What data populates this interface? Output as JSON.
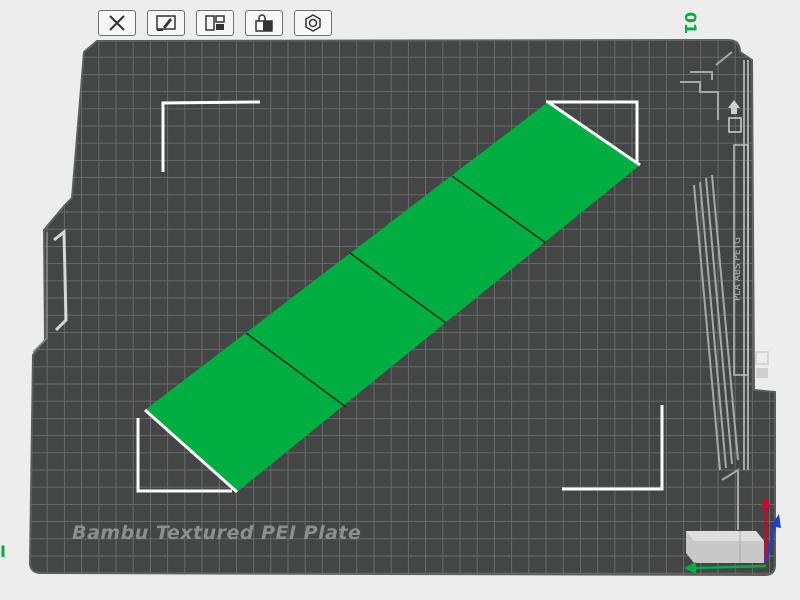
{
  "toolbar": {
    "buttons": [
      {
        "name": "close-view-button",
        "icon": "close-box-icon"
      },
      {
        "name": "paint-tool-button",
        "icon": "paint-brush-icon"
      },
      {
        "name": "arrange-button",
        "icon": "layout-grid-icon"
      },
      {
        "name": "lock-plate-button",
        "icon": "lock-icon"
      },
      {
        "name": "plate-settings-button",
        "icon": "hex-nut-icon"
      }
    ]
  },
  "plate": {
    "number": "01",
    "name": "Bambu Textured PEI Plate",
    "side_label": "PLA ABS PETG"
  },
  "left_marker": "I",
  "colors": {
    "background": "#ededed",
    "plate": "#444645",
    "grid": "#6b6d6c",
    "model": "#00ae42",
    "accent": "#00ae42",
    "axis_x": "#d9002b",
    "axis_y": "#00ae42",
    "axis_z": "#1f3fcf"
  }
}
